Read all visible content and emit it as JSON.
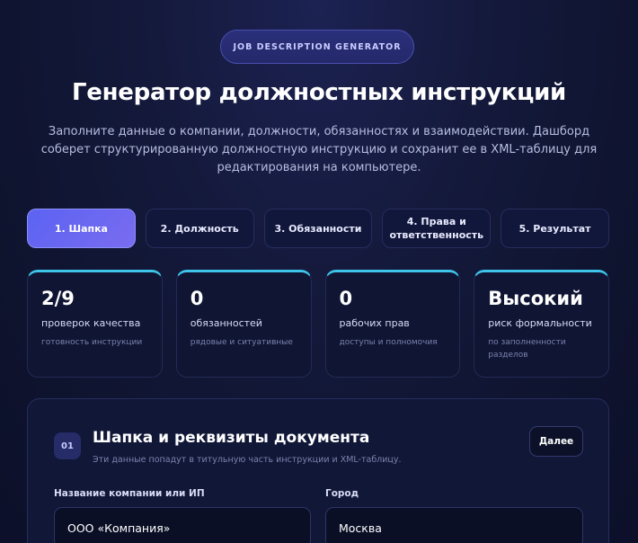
{
  "header": {
    "badge": "JOB DESCRIPTION GENERATOR",
    "title": "Генератор должностных инструкций",
    "subtitle": "Заполните данные о компании, должности, обязанностях и взаимодействии. Дашборд соберет структурированную должностную инструкцию и сохранит ее в XML-таблицу для редактирования на компьютере."
  },
  "tabs": [
    {
      "label": "1. Шапка",
      "active": true
    },
    {
      "label": "2. Должность",
      "active": false
    },
    {
      "label": "3. Обязанности",
      "active": false
    },
    {
      "label": "4. Права и ответственность",
      "active": false
    },
    {
      "label": "5. Результат",
      "active": false
    }
  ],
  "stats": [
    {
      "value": "2/9",
      "label": "проверок качества",
      "hint": "готовность инструкции"
    },
    {
      "value": "0",
      "label": "обязанностей",
      "hint": "рядовые и ситуативные"
    },
    {
      "value": "0",
      "label": "рабочих прав",
      "hint": "доступы и полномочия"
    },
    {
      "value": "Высокий",
      "label": "риск формальности",
      "hint": "по заполненности разделов"
    }
  ],
  "panel": {
    "step": "01",
    "title": "Шапка и реквизиты документа",
    "subtitle": "Эти данные попадут в титульную часть инструкции и XML-таблицу.",
    "next_label": "Далее",
    "fields": {
      "company": {
        "label": "Название компании или ИП",
        "value": "ООО «Компания»"
      },
      "city": {
        "label": "Город",
        "value": "Москва"
      }
    }
  },
  "colors": {
    "accent": "#5b63f2",
    "stat_top_border": "#3ec3e9",
    "background": "#151a3d"
  }
}
